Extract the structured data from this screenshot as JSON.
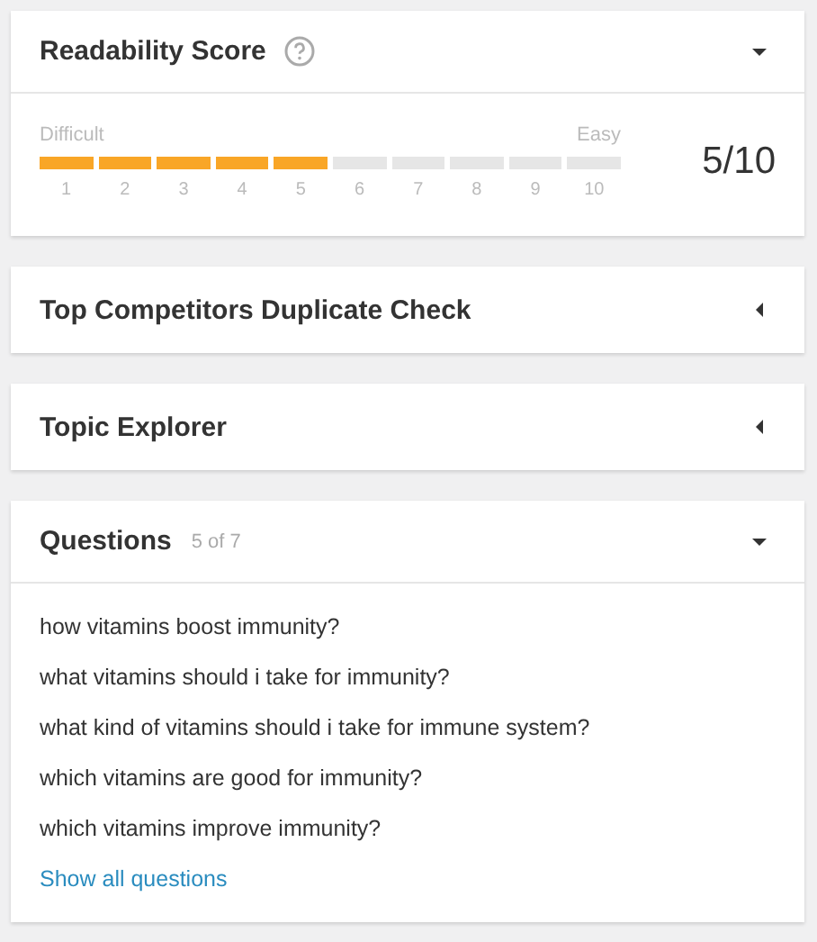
{
  "readability": {
    "title": "Readability Score",
    "expanded": true,
    "left_label": "Difficult",
    "right_label": "Easy",
    "ticks": [
      {
        "label": "1",
        "filled": true
      },
      {
        "label": "2",
        "filled": true
      },
      {
        "label": "3",
        "filled": true
      },
      {
        "label": "4",
        "filled": true
      },
      {
        "label": "5",
        "filled": true
      },
      {
        "label": "6",
        "filled": false
      },
      {
        "label": "7",
        "filled": false
      },
      {
        "label": "8",
        "filled": false
      },
      {
        "label": "9",
        "filled": false
      },
      {
        "label": "10",
        "filled": false
      }
    ],
    "score": "5/10"
  },
  "collapsed_panels": [
    {
      "title": "Top Competitors Duplicate Check",
      "expanded": false
    },
    {
      "title": "Topic Explorer",
      "expanded": false
    }
  ],
  "questions": {
    "title": "Questions",
    "count": "5 of 7",
    "expanded": true,
    "items": [
      "how vitamins boost immunity?",
      "what vitamins should i take for immunity?",
      "what kind of vitamins should i take for immune system?",
      "which vitamins are good for immunity?",
      "which vitamins improve immunity?"
    ],
    "link": "Show all questions"
  }
}
